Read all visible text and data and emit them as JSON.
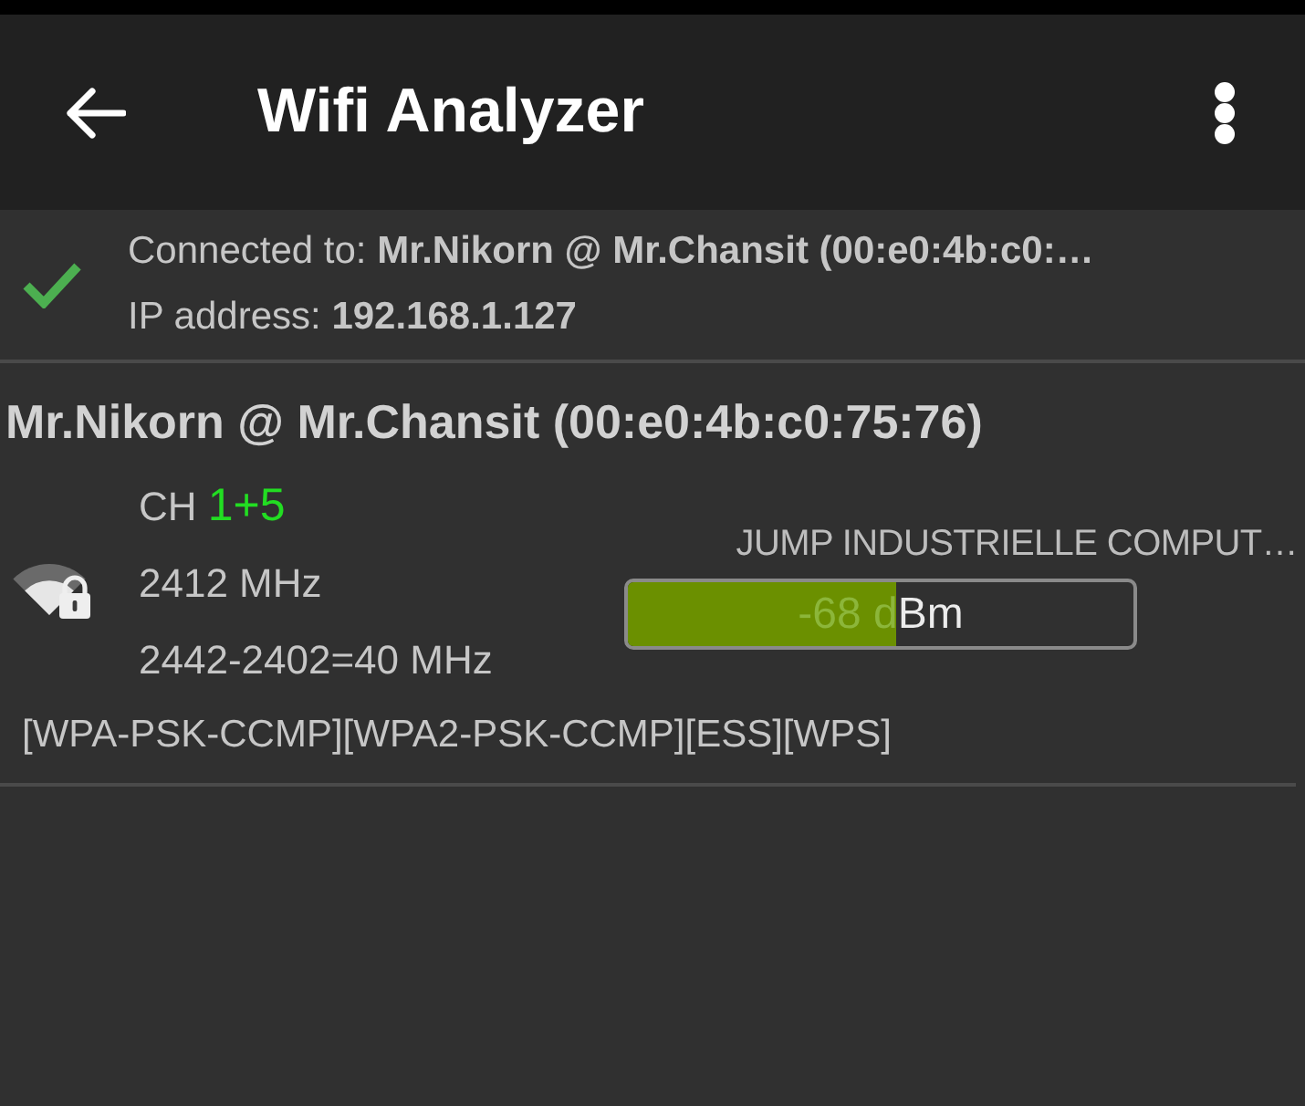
{
  "toolbar": {
    "title": "Wifi Analyzer"
  },
  "connection": {
    "connected_to": "Connected to: **Mr.Nikorn @ Mr.Chansit (00:e0:4b:c0:…**",
    "ip_address": "IP address: **192.168.1.127**"
  },
  "networks": [
    {
      "name": "Mr.Nikorn @ Mr.Chansit (00:e0:4b:c0:75:76)",
      "secured": true,
      "channel_label": "CH",
      "channel": "1+5",
      "frequency": "2412 MHz",
      "width": "2442-2402=40 MHz",
      "vendor": "JUMP INDUSTRIELLE COMPUT…",
      "level": 0.53,
      "reading": "-68 dBm",
      "security": "[WPA-PSK-CCMP][WPA2-PSK-CCMP][ESS][WPS]"
    }
  ]
}
